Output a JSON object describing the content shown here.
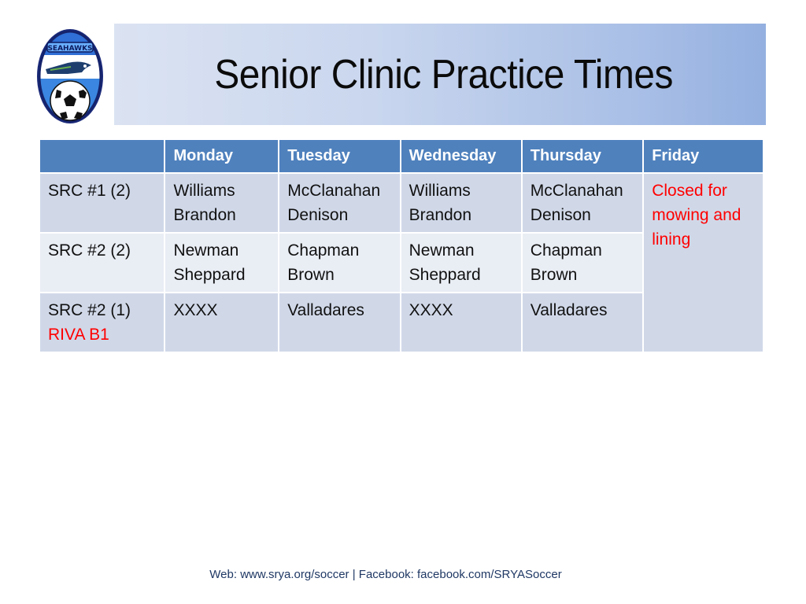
{
  "logo": {
    "icon": "seahawks-soccer-logo",
    "label": "SEAHAWKS"
  },
  "title": "Senior Clinic Practice Times",
  "schedule": {
    "headers": [
      "",
      "Monday",
      "Tuesday",
      "Wednesday",
      "Thursday",
      "Friday"
    ],
    "rows": [
      {
        "label": "SRC #1 (2)",
        "sublabel": "",
        "cells": [
          [
            "Williams",
            "Brandon"
          ],
          [
            "McClanahan",
            "Denison"
          ],
          [
            "Williams",
            "Brandon"
          ],
          [
            "McClanahan",
            "Denison"
          ]
        ]
      },
      {
        "label": "SRC #2 (2)",
        "sublabel": "",
        "cells": [
          [
            "Newman",
            "Sheppard"
          ],
          [
            "Chapman",
            "Brown"
          ],
          [
            "Newman",
            "Sheppard"
          ],
          [
            "Chapman",
            "Brown"
          ]
        ]
      },
      {
        "label": "SRC #2 (1)",
        "sublabel": "RIVA B1",
        "cells": [
          [
            "XXXX",
            ""
          ],
          [
            "Valladares",
            ""
          ],
          [
            "XXXX",
            ""
          ],
          [
            "Valladares",
            ""
          ]
        ]
      }
    ],
    "friday_note": "Closed for mowing and lining"
  },
  "footer": "Web:  www.srya.org/soccer |  Facebook: facebook.com/SRYASoccer",
  "colors": {
    "header_bg": "#4f81bd",
    "row_dark": "#d0d8e8",
    "row_light": "#e9edf4",
    "alert_text": "#ff0000",
    "footer_text": "#1f3864"
  }
}
